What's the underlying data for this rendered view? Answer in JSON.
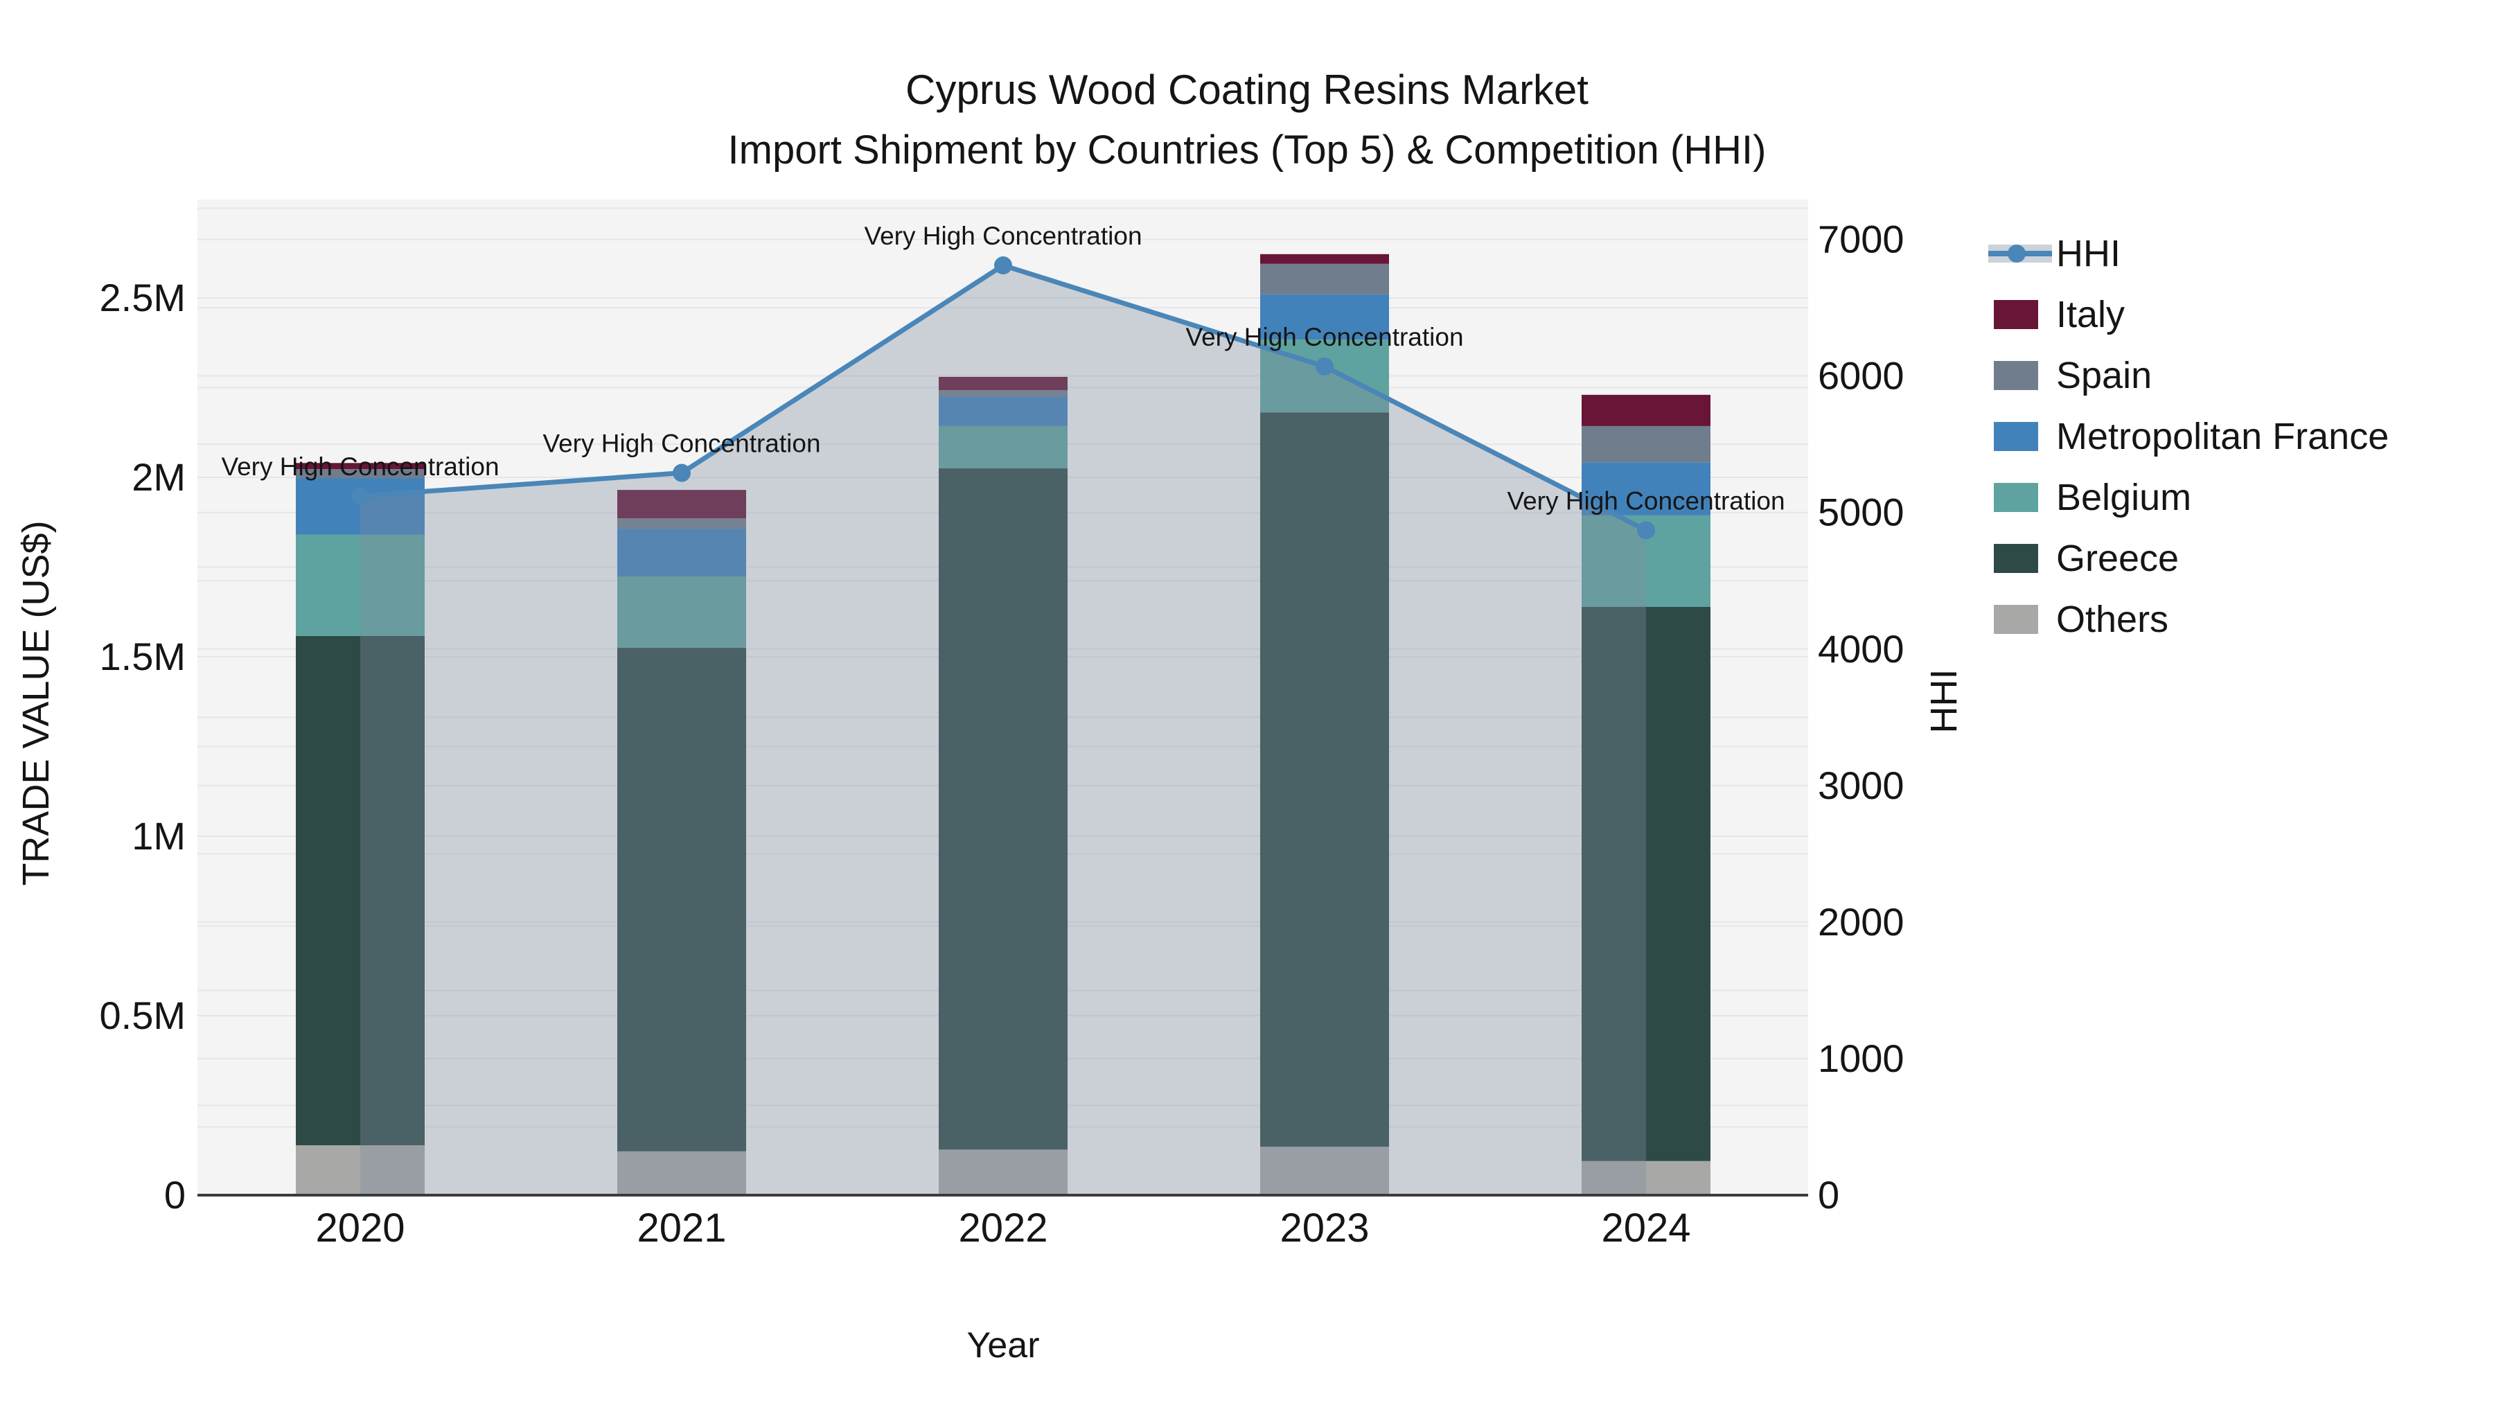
{
  "title": {
    "line1": "Cyprus Wood Coating Resins Market",
    "line2": "Import Shipment by Countries (Top 5) & Competition (HHI)"
  },
  "axes": {
    "x": {
      "title": "Year",
      "categories": [
        "2020",
        "2021",
        "2022",
        "2023",
        "2024"
      ]
    },
    "y_left": {
      "title": "TRADE VALUE (US$)",
      "tick_labels": [
        "0",
        "0.5M",
        "1M",
        "1.5M",
        "2M",
        "2.5M"
      ],
      "tick_values": [
        0,
        500000,
        1000000,
        1500000,
        2000000,
        2500000
      ],
      "range": [
        0,
        2775000
      ]
    },
    "y_right": {
      "title": "HHI",
      "tick_labels": [
        "0",
        "1000",
        "2000",
        "3000",
        "4000",
        "5000",
        "6000",
        "7000"
      ],
      "tick_values": [
        0,
        1000,
        2000,
        3000,
        4000,
        5000,
        6000,
        7000
      ],
      "range": [
        0,
        7290
      ]
    }
  },
  "legend": {
    "position": "right",
    "items": [
      {
        "label": "HHI",
        "type": "line",
        "color": "#4a86b8"
      },
      {
        "label": "Italy",
        "type": "patch",
        "color": "#681537"
      },
      {
        "label": "Spain",
        "type": "patch",
        "color": "#6f7d8c"
      },
      {
        "label": "Metropolitan France",
        "type": "patch",
        "color": "#4282ba"
      },
      {
        "label": "Belgium",
        "type": "patch",
        "color": "#5ea39f"
      },
      {
        "label": "Greece",
        "type": "patch",
        "color": "#2e4a47"
      },
      {
        "label": "Others",
        "type": "patch",
        "color": "#a8a8a6"
      }
    ]
  },
  "colors": {
    "plot_bg": "#f4f4f4",
    "grid": "#e6e6e8",
    "axis_line": "#3c3c3c",
    "text": "#151515",
    "hhi_line": "#4a86b8",
    "hhi_legend_band": "#ccd2da",
    "hhi_area_fill": "rgba(125,140,160,0.35)"
  },
  "chart_data": {
    "type": "combo: stacked bar (left axis) + line with markers and area fill (right axis)",
    "title": "Cyprus Wood Coating Resins Market — Import Shipment by Countries (Top 5) & Competition (HHI)",
    "xlabel": "Year",
    "ylabel_left": "TRADE VALUE (US$)",
    "ylabel_right": "HHI",
    "grid": true,
    "legend_position": "right",
    "categories": [
      "2020",
      "2021",
      "2022",
      "2023",
      "2024"
    ],
    "stack_order_bottom_to_top": [
      "Others",
      "Greece",
      "Belgium",
      "Metropolitan France",
      "Spain",
      "Italy"
    ],
    "bar_series": [
      {
        "name": "Others",
        "color": "#a8a8a6",
        "values": [
          139000,
          122000,
          127000,
          135000,
          95000
        ]
      },
      {
        "name": "Greece",
        "color": "#2e4a47",
        "values": [
          1419000,
          1403000,
          1898000,
          2046000,
          1544000
        ]
      },
      {
        "name": "Belgium",
        "color": "#5ea39f",
        "values": [
          282000,
          199000,
          118000,
          203000,
          255000
        ]
      },
      {
        "name": "Metropolitan France",
        "color": "#4282ba",
        "values": [
          158000,
          133000,
          81000,
          126000,
          148000
        ]
      },
      {
        "name": "Spain",
        "color": "#6f7d8c",
        "values": [
          25000,
          29000,
          19000,
          85000,
          101000
        ]
      },
      {
        "name": "Italy",
        "color": "#681537",
        "values": [
          17000,
          79000,
          37000,
          27000,
          87000
        ]
      }
    ],
    "bar_totals_usd": [
      2040000,
      1965000,
      2280000,
      2622000,
      2230000
    ],
    "line_series": {
      "name": "HHI",
      "axis": "right",
      "color": "#4a86b8",
      "area_fill": "rgba(125,140,160,0.35)",
      "values": [
        5120,
        5290,
        6810,
        6070,
        4870
      ]
    },
    "annotations": [
      {
        "category": "2020",
        "text": "Very High Concentration"
      },
      {
        "category": "2021",
        "text": "Very High Concentration"
      },
      {
        "category": "2022",
        "text": "Very High Concentration"
      },
      {
        "category": "2023",
        "text": "Very High Concentration"
      },
      {
        "category": "2024",
        "text": "Very High Concentration"
      }
    ]
  }
}
